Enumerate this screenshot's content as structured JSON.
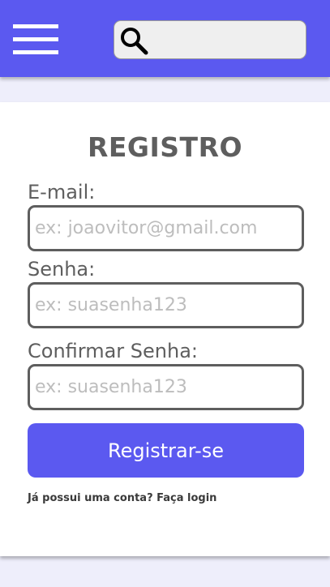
{
  "header": {
    "menu_icon": "hamburger-menu-icon",
    "search": {
      "icon": "search-icon",
      "placeholder": "",
      "value": ""
    },
    "colors": {
      "background": "#5b59f0",
      "search_background": "#efefef"
    }
  },
  "form": {
    "title": "REGISTRO",
    "fields": [
      {
        "label": "E-mail:",
        "placeholder": "ex: joaovitor@gmail.com",
        "value": ""
      },
      {
        "label": "Senha:",
        "placeholder": "ex: suasenha123",
        "value": ""
      },
      {
        "label": "Confirmar Senha:",
        "placeholder": "ex: suasenha123",
        "value": ""
      }
    ],
    "submit_label": "Registrar-se",
    "login_prompt": "Já possui uma conta?",
    "login_link": "Faça login",
    "colors": {
      "accent": "#5b59f0",
      "text": "#5e5e5e",
      "placeholder": "#bdbdbd"
    }
  }
}
